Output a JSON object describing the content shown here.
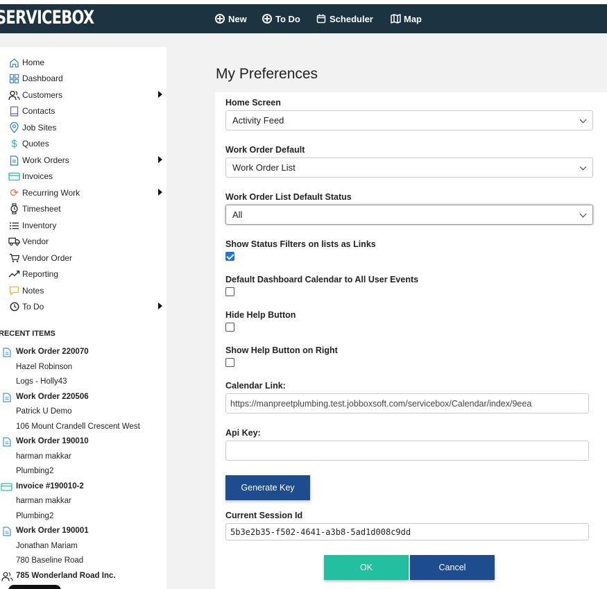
{
  "header": {
    "logo": "SERVICEBOX",
    "nav": [
      {
        "label": "New",
        "icon": "circle-plus-icon"
      },
      {
        "label": "To Do",
        "icon": "circle-plus-icon"
      },
      {
        "label": "Scheduler",
        "icon": "calendar-icon"
      },
      {
        "label": "Map",
        "icon": "map-icon"
      }
    ]
  },
  "sidebar": {
    "items": [
      {
        "label": "Home",
        "icon": "home-icon"
      },
      {
        "label": "Dashboard",
        "icon": "dashboard-icon"
      },
      {
        "label": "Customers",
        "icon": "people-icon"
      },
      {
        "label": "Contacts",
        "icon": "book-icon"
      },
      {
        "label": "Job Sites",
        "icon": "location-pin-icon"
      },
      {
        "label": "Quotes",
        "icon": "dollar-icon"
      },
      {
        "label": "Work Orders",
        "icon": "document-icon"
      },
      {
        "label": "Invoices",
        "icon": "credit-card-icon"
      },
      {
        "label": "Recurring Work",
        "icon": "recurring-icon"
      },
      {
        "label": "Timesheet",
        "icon": "watch-icon"
      },
      {
        "label": "Inventory",
        "icon": "list-icon"
      },
      {
        "label": "Vendor",
        "icon": "truck-icon"
      },
      {
        "label": "Vendor Order",
        "icon": "cart-icon"
      },
      {
        "label": "Reporting",
        "icon": "trend-icon"
      },
      {
        "label": "Notes",
        "icon": "note-icon"
      },
      {
        "label": "To Do",
        "icon": "clock-icon"
      }
    ],
    "recent_heading": "RECENT ITEMS",
    "recent": [
      {
        "title": "Work Order 220070",
        "lines": [
          "Hazel Robinson",
          "Logs - Holly43"
        ],
        "icon": "document-icon"
      },
      {
        "title": "Work Order 220506",
        "lines": [
          "Patrick U Demo",
          "106 Mount Crandell Crescent West"
        ],
        "icon": "document-icon"
      },
      {
        "title": "Work Order 190010",
        "lines": [
          "harman makkar",
          "Plumbing2"
        ],
        "icon": "document-icon"
      },
      {
        "title": "Invoice #190010-2",
        "lines": [
          "harman makkar",
          "Plumbing2"
        ],
        "icon": "credit-card-icon"
      },
      {
        "title": "Work Order 190001",
        "lines": [
          "Jonathan Mariam",
          "780 Baseline Road"
        ],
        "icon": "document-icon"
      },
      {
        "title": "785 Wonderland Road Inc.",
        "lines": [],
        "icon": "people-icon"
      }
    ]
  },
  "main": {
    "title": "My Preferences",
    "home_screen": {
      "label": "Home Screen",
      "value": "Activity Feed"
    },
    "work_order_default": {
      "label": "Work Order Default",
      "value": "Work Order List"
    },
    "wo_list_status": {
      "label": "Work Order List Default Status",
      "value": "All"
    },
    "show_status_filters": {
      "label": "Show Status Filters on lists as Links",
      "checked": true
    },
    "default_dashboard_calendar": {
      "label": "Default Dashboard Calendar to All User Events",
      "checked": false
    },
    "hide_help": {
      "label": "Hide Help Button",
      "checked": false
    },
    "help_right": {
      "label": "Show Help Button on Right",
      "checked": false
    },
    "calendar_link": {
      "label": "Calendar Link:",
      "value": "https://manpreetplumbing.test.jobboxsoft.com/servicebox/Calendar/index/9eea"
    },
    "api_key": {
      "label": "Api Key:",
      "value": ""
    },
    "generate_label": "Generate Key",
    "session": {
      "label": "Current Session Id",
      "value": "5b3e2b35-f502-4641-a3b8-5ad1d008c9dd"
    },
    "ok_label": "OK",
    "cancel_label": "Cancel"
  },
  "colors": {
    "header_bg": "#1c3441",
    "primary_button": "#1d4c8f",
    "ok_button": "#22bfa0",
    "icon_blue": "#3b82c4"
  }
}
